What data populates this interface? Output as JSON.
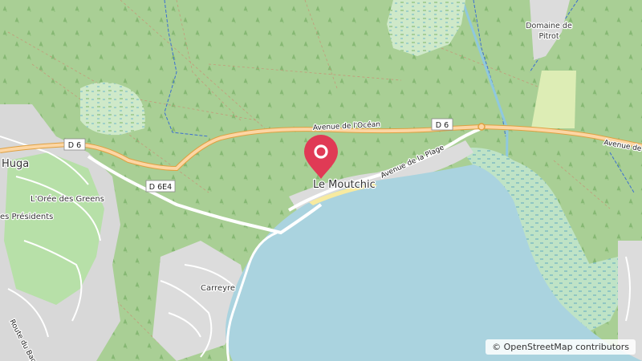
{
  "map": {
    "places": {
      "le_moutchic": "Le Moutchic",
      "huga": "Huga",
      "loree_des_greens": "L'Orée des Greens",
      "les_presidents": "es Présidents",
      "carreyre": "Carreyre",
      "domaine_de_pitrot_line1": "Domaine de",
      "domaine_de_pitrot_line2": "Pitrot"
    },
    "roads": {
      "avenue_ocean": "Avenue de l'Océan",
      "avenue_ocean_east": "Avenue de l",
      "avenue_plage": "Avenue de la Plage",
      "route_bagaran": "Route du Bagara"
    },
    "shields": {
      "d6_west": "D 6",
      "d6_east": "D 6",
      "d6e4": "D 6E4"
    },
    "marker": {
      "icon": "map-pin-icon",
      "color": "#e03a55"
    }
  },
  "attribution": {
    "symbol": "©",
    "text": "OpenStreetMap contributors"
  }
}
